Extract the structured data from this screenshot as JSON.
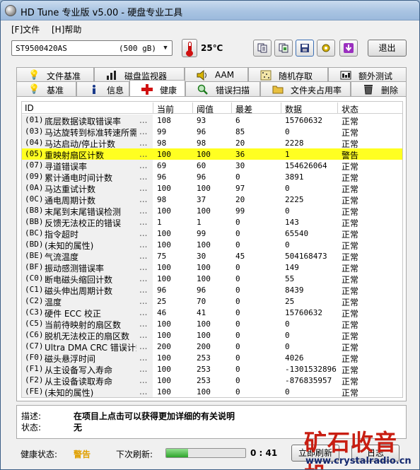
{
  "window": {
    "title": "HD Tune 专业版 v5.00 - 硬盘专业工具"
  },
  "menu": [
    {
      "label": "[F]文件"
    },
    {
      "label": "[H]帮助"
    }
  ],
  "toolbar": {
    "drive_model": "ST9500420AS",
    "drive_size": "(500 gB)",
    "temperature": "25℃",
    "exit_label": "退出",
    "icons": [
      "copy-text-icon",
      "copy-screenshot-icon",
      "save-icon",
      "options-icon",
      "download-icon"
    ]
  },
  "tabs_back": [
    {
      "label": "文件基准",
      "icon": "file-benchmark-icon"
    },
    {
      "label": "磁盘监视器",
      "icon": "disk-monitor-icon"
    },
    {
      "label": "AAM",
      "icon": "speaker-icon"
    },
    {
      "label": "随机存取",
      "icon": "random-access-icon"
    },
    {
      "label": "额外测试",
      "icon": "extra-tests-icon"
    }
  ],
  "tabs_front": [
    {
      "label": "基准",
      "icon": "benchmark-icon"
    },
    {
      "label": "信息",
      "icon": "info-icon"
    },
    {
      "label": "健康",
      "icon": "health-cross-icon",
      "active": true
    },
    {
      "label": "错误扫描",
      "icon": "magnifier-icon"
    },
    {
      "label": "文件夹占用率",
      "icon": "folder-icon"
    },
    {
      "label": "删除",
      "icon": "trash-icon"
    }
  ],
  "table": {
    "columns": [
      "ID",
      "当前",
      "阈值",
      "最差",
      "数据",
      "状态"
    ],
    "rows": [
      {
        "code": "(01)",
        "name": "底层数据读取错误率",
        "dots": "...",
        "current": "108",
        "threshold": "93",
        "worst": "6",
        "data": "15760632",
        "status": "正常"
      },
      {
        "code": "(03)",
        "name": "马达旋转到标准转速所需时间",
        "dots": "...",
        "current": "99",
        "threshold": "96",
        "worst": "85",
        "data": "0",
        "status": "正常"
      },
      {
        "code": "(04)",
        "name": "马达启动/停止计数",
        "dots": "...",
        "current": "98",
        "threshold": "98",
        "worst": "20",
        "data": "2228",
        "status": "正常"
      },
      {
        "code": "(05)",
        "name": "重映射扇区计数",
        "dots": "...",
        "current": "100",
        "threshold": "100",
        "worst": "36",
        "data": "1",
        "status": "警告",
        "highlight": true
      },
      {
        "code": "(07)",
        "name": "寻道错误率",
        "dots": "...",
        "current": "69",
        "threshold": "60",
        "worst": "30",
        "data": "154626064",
        "status": "正常"
      },
      {
        "code": "(09)",
        "name": "累计通电时间计数",
        "dots": "...",
        "current": "96",
        "threshold": "96",
        "worst": "0",
        "data": "3891",
        "status": "正常"
      },
      {
        "code": "(0A)",
        "name": "马达重试计数",
        "dots": "...",
        "current": "100",
        "threshold": "100",
        "worst": "97",
        "data": "0",
        "status": "正常"
      },
      {
        "code": "(0C)",
        "name": "通电周期计数",
        "dots": "...",
        "current": "98",
        "threshold": "37",
        "worst": "20",
        "data": "2225",
        "status": "正常"
      },
      {
        "code": "(B8)",
        "name": "末尾到末尾错误检测",
        "dots": "...",
        "current": "100",
        "threshold": "100",
        "worst": "99",
        "data": "0",
        "status": "正常"
      },
      {
        "code": "(BB)",
        "name": "反馈无法校正的错误",
        "dots": "...",
        "current": "1",
        "threshold": "1",
        "worst": "0",
        "data": "143",
        "status": "正常"
      },
      {
        "code": "(BC)",
        "name": "指令超时",
        "dots": "...",
        "current": "100",
        "threshold": "99",
        "worst": "0",
        "data": "65540",
        "status": "正常"
      },
      {
        "code": "(BD)",
        "name": "(未知的属性)",
        "dots": "...",
        "current": "100",
        "threshold": "100",
        "worst": "0",
        "data": "0",
        "status": "正常"
      },
      {
        "code": "(BE)",
        "name": "气流温度",
        "dots": "...",
        "current": "75",
        "threshold": "30",
        "worst": "45",
        "data": "504168473",
        "status": "正常"
      },
      {
        "code": "(BF)",
        "name": "振动感测错误率",
        "dots": "...",
        "current": "100",
        "threshold": "100",
        "worst": "0",
        "data": "149",
        "status": "正常"
      },
      {
        "code": "(C0)",
        "name": "断电磁头缩回计数",
        "dots": "...",
        "current": "100",
        "threshold": "100",
        "worst": "0",
        "data": "55",
        "status": "正常"
      },
      {
        "code": "(C1)",
        "name": "磁头伸出周期计数",
        "dots": "...",
        "current": "96",
        "threshold": "96",
        "worst": "0",
        "data": "8439",
        "status": "正常"
      },
      {
        "code": "(C2)",
        "name": "温度",
        "dots": "...",
        "current": "25",
        "threshold": "70",
        "worst": "0",
        "data": "25",
        "status": "正常"
      },
      {
        "code": "(C3)",
        "name": "硬件 ECC 校正",
        "dots": "...",
        "current": "46",
        "threshold": "41",
        "worst": "0",
        "data": "15760632",
        "status": "正常"
      },
      {
        "code": "(C5)",
        "name": "当前待映射的扇区数",
        "dots": "...",
        "current": "100",
        "threshold": "100",
        "worst": "0",
        "data": "0",
        "status": "正常"
      },
      {
        "code": "(C6)",
        "name": "脱机无法校正的扇区数",
        "dots": "...",
        "current": "100",
        "threshold": "100",
        "worst": "0",
        "data": "0",
        "status": "正常"
      },
      {
        "code": "(C7)",
        "name": "Ultra DMA CRC 错误计数",
        "dots": "...",
        "current": "200",
        "threshold": "200",
        "worst": "0",
        "data": "0",
        "status": "正常"
      },
      {
        "code": "(F0)",
        "name": "磁头悬浮时间",
        "dots": "...",
        "current": "100",
        "threshold": "253",
        "worst": "0",
        "data": "4026",
        "status": "正常"
      },
      {
        "code": "(F1)",
        "name": "从主设备写入寿命",
        "dots": "...",
        "current": "100",
        "threshold": "253",
        "worst": "0",
        "data": "-1301532896",
        "status": "正常"
      },
      {
        "code": "(F2)",
        "name": "从主设备读取寿命",
        "dots": "...",
        "current": "100",
        "threshold": "253",
        "worst": "0",
        "data": "-876835957",
        "status": "正常"
      },
      {
        "code": "(FE)",
        "name": "(未知的属性)",
        "dots": "...",
        "current": "100",
        "threshold": "100",
        "worst": "0",
        "data": "0",
        "status": "正常"
      }
    ]
  },
  "description": {
    "label": "描述:",
    "value": "在项目上点击可以获得更加详细的有关说明",
    "status_label": "状态:",
    "status_value": "无"
  },
  "statusbar": {
    "health_label": "健康状态:",
    "health_value": "警告",
    "health_color": "#e0a000",
    "next_refresh_label": "下次刷新:",
    "refresh_progress": 0.28,
    "countdown": "0 : 41",
    "refresh_button": "立即刷新",
    "log_button": "日志"
  },
  "watermark": {
    "main": "矿石收音机",
    "url": "www.crystalradio.cn"
  }
}
